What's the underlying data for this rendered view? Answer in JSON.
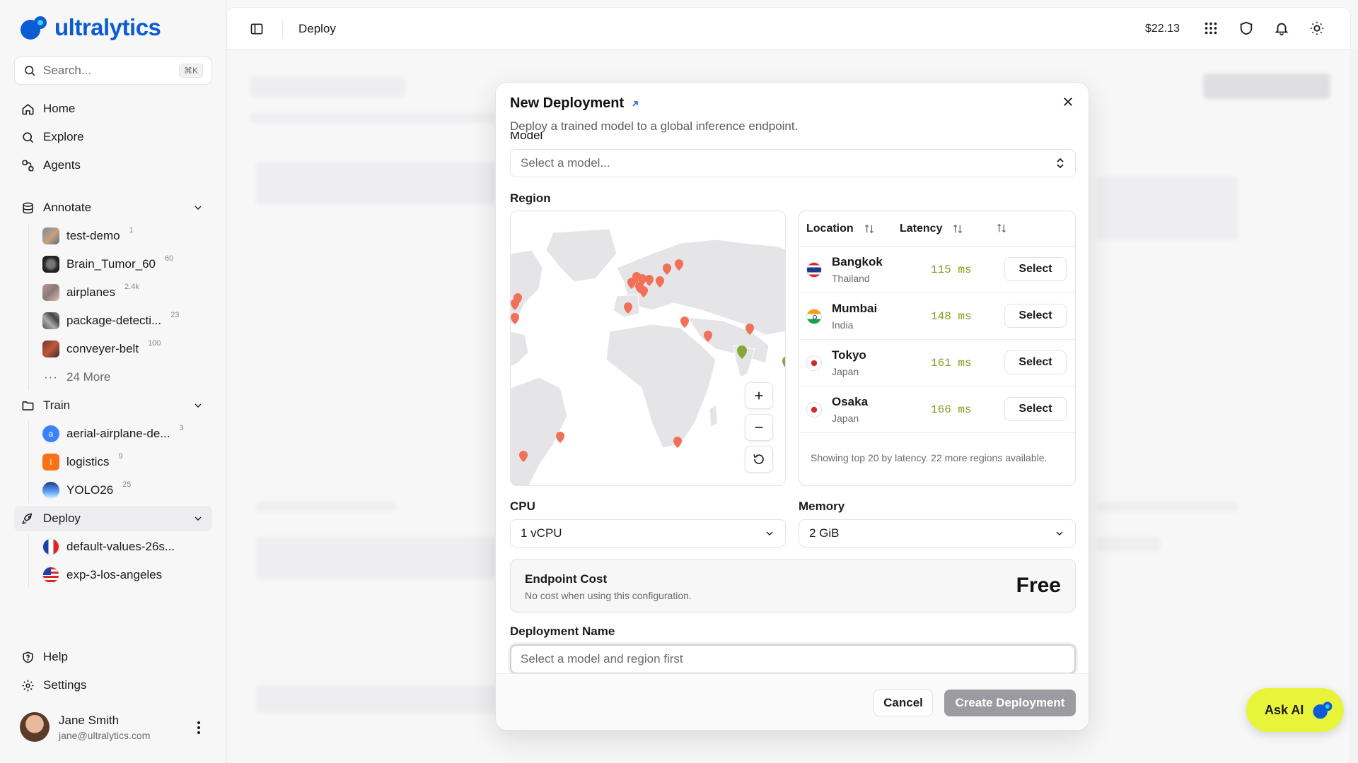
{
  "app": {
    "logo_text": "ultralytics",
    "brand_color": "#0b5bd3"
  },
  "search": {
    "placeholder": "Search...",
    "shortcut": "⌘K"
  },
  "nav": {
    "home": "Home",
    "explore": "Explore",
    "agents": "Agents",
    "annotate": "Annotate",
    "train": "Train",
    "deploy": "Deploy",
    "help": "Help",
    "settings": "Settings"
  },
  "annotate_items": [
    {
      "label": "test-demo",
      "count": "1"
    },
    {
      "label": "Brain_Tumor_60",
      "count": "60"
    },
    {
      "label": "airplanes",
      "count": "2.4k"
    },
    {
      "label": "package-detecti...",
      "count": "23"
    },
    {
      "label": "conveyer-belt",
      "count": "100"
    }
  ],
  "annotate_more": "24 More",
  "train_items": [
    {
      "label": "aerial-airplane-de...",
      "count": "3",
      "initial": "a",
      "color": "#3b82f6"
    },
    {
      "label": "logistics",
      "count": "9",
      "initial": "l",
      "color": "#f97316"
    },
    {
      "label": "YOLO26",
      "count": "25"
    }
  ],
  "deploy_items": [
    {
      "label": "default-values-26s..."
    },
    {
      "label": "exp-3-los-angeles"
    }
  ],
  "user": {
    "name": "Jane Smith",
    "email": "jane@ultralytics.com"
  },
  "topbar": {
    "breadcrumb": "Deploy",
    "credits": "$22.13"
  },
  "modal": {
    "title": "New Deployment",
    "subtitle": "Deploy a trained model to a global inference endpoint.",
    "model_label": "Model",
    "model_placeholder": "Select a model...",
    "region_label": "Region",
    "table_headers": {
      "location": "Location",
      "latency": "Latency"
    },
    "regions": [
      {
        "city": "Bangkok",
        "country": "Thailand",
        "latency": "115 ms",
        "action": "Select"
      },
      {
        "city": "Mumbai",
        "country": "India",
        "latency": "148 ms",
        "action": "Select"
      },
      {
        "city": "Tokyo",
        "country": "Japan",
        "latency": "161 ms",
        "action": "Select"
      },
      {
        "city": "Osaka",
        "country": "Japan",
        "latency": "166 ms",
        "action": "Select"
      }
    ],
    "table_footer": "Showing top 20 by latency. 22 more regions available.",
    "cpu_label": "CPU",
    "cpu_value": "1 vCPU",
    "memory_label": "Memory",
    "memory_value": "2 GiB",
    "cost_title": "Endpoint Cost",
    "cost_sub": "No cost when using this configuration.",
    "cost_value": "Free",
    "name_label": "Deployment Name",
    "name_placeholder": "Select a model and region first",
    "cancel": "Cancel",
    "create": "Create Deployment"
  },
  "ask_ai": "Ask AI"
}
